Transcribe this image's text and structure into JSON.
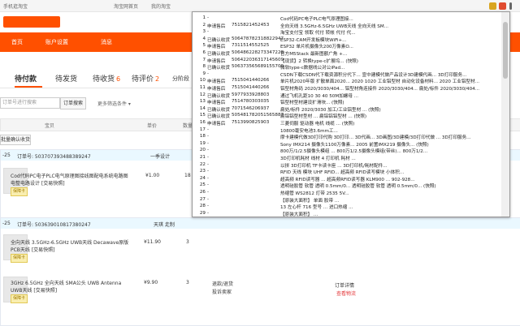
{
  "topbar": {
    "home": "手机逛淘宝",
    "taobao_home": "淘宝网首页",
    "my_taobao": "我的淘宝"
  },
  "nav": {
    "home": "首页",
    "account": "账户设置",
    "messages": "消息"
  },
  "tabs": [
    {
      "label": "待付款",
      "count": ""
    },
    {
      "label": "待发货",
      "count": ""
    },
    {
      "label": "待收货",
      "count": "6"
    },
    {
      "label": "待评价",
      "count": "2"
    },
    {
      "label": "分阶段",
      "count": ""
    }
  ],
  "search": {
    "placeholder": "订单号进行搜索",
    "button": "订单搜索",
    "more": "更多筛选条件 ▾"
  },
  "table_headers": {
    "baby": "宝贝",
    "price": "单价",
    "qty": "数量"
  },
  "batch_button": "批量确认收货",
  "orders": [
    {
      "date": "-25",
      "order_no": "订单号: 503707393488389247",
      "shop": "一季设计"
    },
    {
      "date": "-25",
      "order_no": "订单号: 503639010817380247",
      "shop": "天琪 走制"
    }
  ],
  "items": [
    {
      "title": "Cod代码PC电子PLC电气原理图接线图配电系统电路图电整电路设计 [交易快照]",
      "price": "¥1.00",
      "qty": "18",
      "tag": "保障卡"
    },
    {
      "title": "全向天线 3.5GHz-6.5GHz UWB天线 Decawave原版PCB天线 [交易快照]",
      "price": "¥11.90",
      "qty": "3",
      "tag": "保障卡"
    },
    {
      "title": "3GHz 6.5GHz 全向天线 SMA公头 UWB Antenna UWB天线 [交易快照]",
      "price": "¥9.90",
      "qty": "3",
      "tag": "保障卡",
      "extra1": "退款/退货",
      "extra2": "投诉卖家"
    }
  ],
  "bottom_right": {
    "confirm": "订单详情",
    "query": "查看物流"
  },
  "popup_rows": [
    {
      "no": "1",
      "status": "-",
      "id": "",
      "title": "Cod代码PC电子PLC电气原理图接..."
    },
    {
      "no": "2",
      "status": "申请售后",
      "id": "7515821452453",
      "title": "全向天线 3.5GHz-6.5GHz UWB天线 全向天线 SM..."
    },
    {
      "no": "3",
      "status": "-",
      "id": "",
      "title": "淘宝支付宝 领取 代付 转帐 代付 代..."
    },
    {
      "no": "4",
      "status": "已确认收货",
      "id": "506478782318822947",
      "title": "ESP32-CAM开发板模块WiFi+..."
    },
    {
      "no": "5",
      "status": "申请售后",
      "id": "7311514552525",
      "title": "ESP32 单片机摄像头200万像素O..."
    },
    {
      "no": "6",
      "status": "已确认收货",
      "id": "506486228273347228",
      "title": "官方M5Stack 最新图额广角 +..."
    },
    {
      "no": "7",
      "status": "申请售后",
      "id": "506422036317145609",
      "title": "【现货】2 转换type-c扩展坞... (快照)"
    },
    {
      "no": "8",
      "status": "已确认收货",
      "id": "506373565689155700",
      "title": "微软type-c数据线公对公iPad..."
    },
    {
      "no": "9",
      "status": "-",
      "id": "",
      "title": "CSDN下载CSDN代下载资源积分代下... 宣中建模代做产品设计3D建模代画... 3D打印服务..."
    },
    {
      "no": "10",
      "status": "申请售后",
      "id": "7515041440266",
      "title": "单片机2020年版 扩散单面2020... 2020 1020 工业铝型材 自动化设备材料... 2020 工业铝型材..."
    },
    {
      "no": "11",
      "status": "申请售后",
      "id": "7515041440266",
      "title": "铝型材角码 2020/3030/404... 铝型材角连接件 2020/3030/404... 扁处/标件 2020/3030/404..."
    },
    {
      "no": "12",
      "status": "已确认收货",
      "id": "5977933928803",
      "title": "通过飞机孔距10 30 40 50M加螺母 ..."
    },
    {
      "no": "13",
      "status": "申请售后",
      "id": "7514780303035",
      "title": "铝型材型材建设扩滑块... (快照)"
    },
    {
      "no": "14",
      "status": "已确认收货",
      "id": "7071546206937",
      "title": "扁处/标件 2020/3030 加工/工业铝型材 ... (快照)"
    },
    {
      "no": "15",
      "status": "已确认收货",
      "id": "505481782051565887",
      "title": "扁铝铝型材型材 ... 扁铝铝铝型材 ... (快照)"
    },
    {
      "no": "16",
      "status": "申请售后",
      "id": "7513990825903",
      "title": "三菱伺服 驱动器 电机 线缆 ... (快照)"
    },
    {
      "no": "17",
      "status": "-",
      "id": "",
      "title": "10800毫安电池3.6mm工..."
    },
    {
      "no": "18",
      "status": "-",
      "id": "",
      "title": "摩卡建模代做3D打印代购 3D打印... 3D代画... 3D画图/3D建模/3D打印代做 ... 3D打印服务..."
    },
    {
      "no": "19",
      "status": "-",
      "id": "",
      "title": "Sony IMX214 摄像头1100万像素... 2005 前置IMX219 摄像头... (快照)"
    },
    {
      "no": "20",
      "status": "-",
      "id": "",
      "title": "800万/1/2.5摄像头模组 ... 800万1/2.5摄像头模组(带丝)... 800万1/2..."
    },
    {
      "no": "21",
      "status": "-",
      "id": "",
      "title": "3D打印机耗材 线材 4 打印机 耗材 ..."
    },
    {
      "no": "22",
      "status": "-",
      "id": "",
      "title": "以拼 3D打印机 TF卡读卡座 ... 3D打印机/耗材配件..."
    },
    {
      "no": "23",
      "status": "-",
      "id": "",
      "title": "RFID 天线 模块 UHF RFID... 超高频 RFID读写模块 小体积..."
    },
    {
      "no": "24",
      "status": "-",
      "id": "",
      "title": "超高频 RFID读写器 ... 超高频RFID读写器 KLM900 ... 902-928..."
    },
    {
      "no": "25",
      "status": "-",
      "id": "",
      "title": "透明硅胶管 软管 透明 0.5mm/0... 透明硅胶管 软管 透明 0.5mm/0... (快照)"
    },
    {
      "no": "26",
      "status": "-",
      "id": "",
      "title": "热缩管 WS2812 灯带 2535 5V..."
    },
    {
      "no": "27",
      "status": "-",
      "id": "",
      "title": "【原装大面积】 单面 胶带 ..."
    },
    {
      "no": "28",
      "status": "-",
      "id": "",
      "title": "13 左心杆 716 型号 ... 进口热缩 ..."
    },
    {
      "no": "29",
      "status": "-",
      "id": "",
      "title": "【原装大面积】 ..."
    }
  ],
  "colors": {
    "brand": "#ff5000",
    "order_head": "#eaf8ff",
    "popup_border": "#999999"
  }
}
